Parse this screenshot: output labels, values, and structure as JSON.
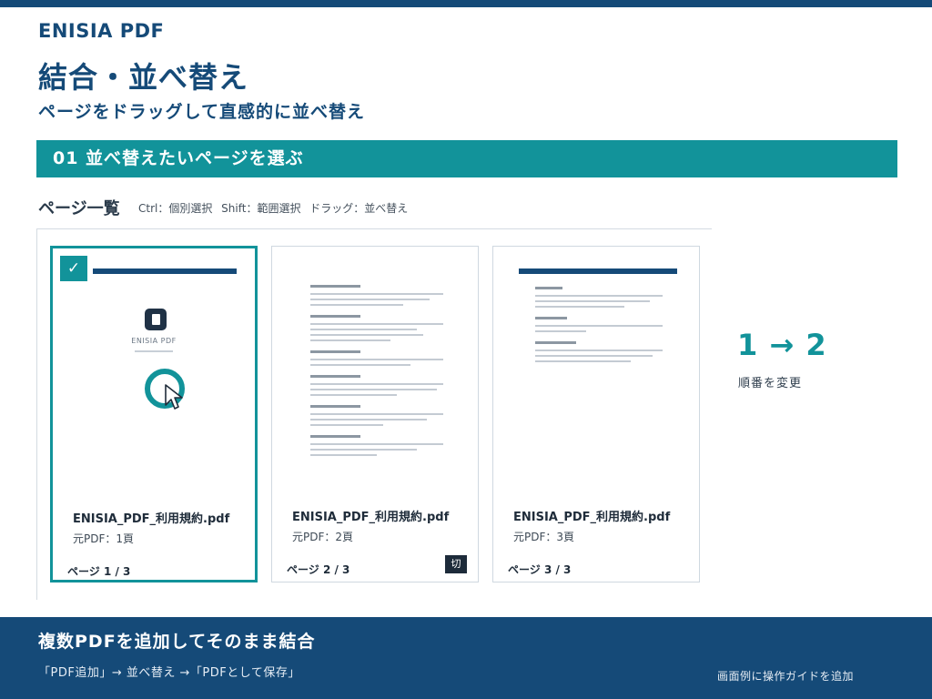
{
  "brand": "ENISIA PDF",
  "title": "結合・並べ替え",
  "subtitle": "ページをドラッグして直感的に並べ替え",
  "step": {
    "label": "01  並べ替えたいページを選ぶ"
  },
  "page_list": {
    "heading": "ページ一覧",
    "hints": "Ctrl：個別選択  Shift：範囲選択  ドラッグ：並べ替え",
    "cards": [
      {
        "file_name": "ENISIA_PDF_利用規約.pdf",
        "origin": "元PDF：1頁",
        "page": "ページ 1 / 3",
        "selected": true,
        "check": "✓",
        "thumb_logo": "ENISIA PDF"
      },
      {
        "file_name": "ENISIA_PDF_利用規約.pdf",
        "origin": "元PDF：2頁",
        "page": "ページ 2 / 3",
        "selected": false,
        "badge": "切"
      },
      {
        "file_name": "ENISIA_PDF_利用規約.pdf",
        "origin": "元PDF：3頁",
        "page": "ページ 3 / 3",
        "selected": false
      }
    ]
  },
  "order_change": {
    "value": "1 → 2",
    "label": "順番を変更"
  },
  "footer": {
    "title": "複数PDFを追加してそのまま結合",
    "flow": "「PDF追加」→ 並べ替え →「PDFとして保存」",
    "note": "画面例に操作ガイドを追加"
  },
  "colors": {
    "navy": "#154a78",
    "teal": "#12939a"
  }
}
